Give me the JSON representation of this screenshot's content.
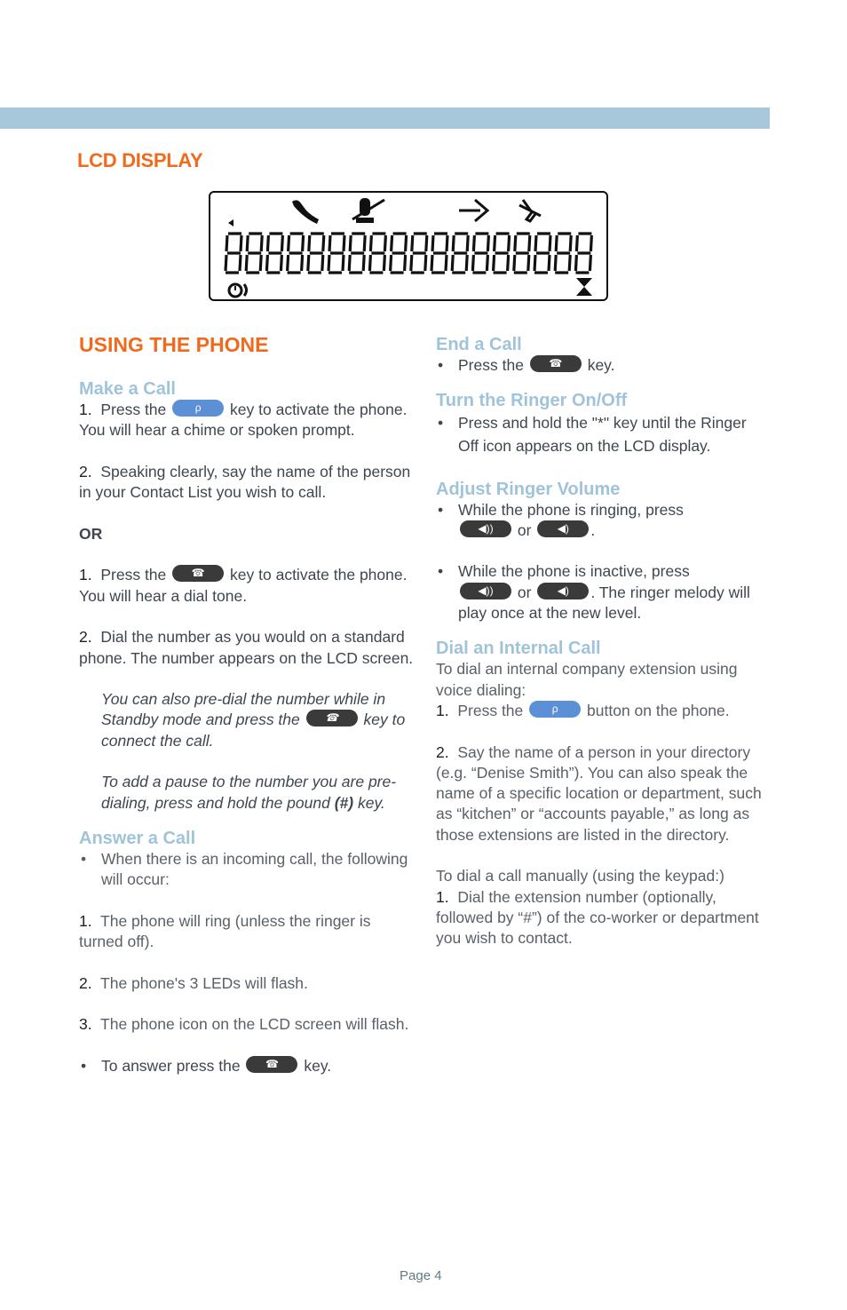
{
  "header": {
    "bar_color": "#a7c8da"
  },
  "lcd_section": {
    "title": "LCD DISPLAY",
    "lcd": {
      "digit_count": 18,
      "digit_glyph": "8",
      "top_icons": [
        "handset-icon",
        "mute-mic-icon",
        "forward-arrow-icon",
        "ringer-off-icon"
      ],
      "left_icon": "volume-arrow-icon",
      "bottom_left_icon": "clock-call-icon",
      "bottom_right_icon": "hourglass-icon"
    }
  },
  "using_section": {
    "title": "USING THE PHONE",
    "make_call": {
      "heading": "Make a Call",
      "step1_num": "1.",
      "step1_pre": "Press the",
      "step1_post": "key to activate the phone. You will hear a chime or spoken prompt.",
      "step2_num": "2.",
      "step2_text": "Speaking clearly, say the name of the person in your Contact List you wish to call.",
      "or_label": "OR",
      "alt1_num": "1.",
      "alt1_pre": "Press the",
      "alt1_post": "key to activate the phone. You will hear a dial tone.",
      "alt2_num": "2.",
      "alt2_text": "Dial the number as you would on a standard phone. The number appears on the LCD screen.",
      "note1_pre": "You can also pre-dial the number while in Standby mode and press the",
      "note1_post": "key to connect the call.",
      "note2_pre": "To add a pause to the number you are pre-dialing, press and hold the pound",
      "note2_bold": "(#)",
      "note2_post": "key."
    },
    "answer_call": {
      "heading": "Answer a Call",
      "bullet1": "When there is an incoming call, the following will occur:",
      "items": [
        {
          "num": "1.",
          "text": "The phone will ring (unless the ringer is turned off)."
        },
        {
          "num": "2.",
          "text": "The phone's 3 LEDs will flash."
        },
        {
          "num": "3.",
          "text": "The phone icon on the LCD screen will flash."
        }
      ],
      "bullet2_pre": "To answer press the",
      "bullet2_post": "key."
    },
    "end_call": {
      "heading": "End a Call",
      "bullet_pre": "Press the",
      "bullet_post": "key."
    },
    "ringer_onoff": {
      "heading": "Turn the Ringer On/Off",
      "bullet": "Press and hold the \"*\" key until the Ringer Off icon appears on the LCD display."
    },
    "ringer_volume": {
      "heading": "Adjust Ringer Volume",
      "bullet1_pre": "While the phone is ringing, press",
      "bullet1_or": "or",
      "bullet1_post": ".",
      "bullet2_pre": "While the phone is inactive, press",
      "bullet2_or": "or",
      "bullet2_post": ". The ringer melody will play once at the new level."
    },
    "internal_call": {
      "heading": "Dial an Internal Call",
      "intro": "To dial an internal company extension using voice dialing:",
      "step1_num": "1.",
      "step1_pre": "Press the",
      "step1_post": "button on the phone.",
      "step2_num": "2.",
      "step2_text": "Say the name of a person in your directory (e.g. “Denise Smith”). You can also speak the name of a specific location or department, such as “kitchen” or “accounts payable,” as long as those extensions are listed in the directory.",
      "manual_intro": "To dial a call manually (using the keypad:)",
      "manual1_num": "1.",
      "manual1_text": "Dial the extension number (optionally, followed by “#”) of the co-worker or department you wish to contact."
    }
  },
  "keys": {
    "voice_key_glyph": "ρ",
    "handset_key_glyph": "☎",
    "volume_up_glyph": "◀))",
    "volume_down_glyph": "◀)"
  },
  "footer": {
    "page_label": "Page 4"
  },
  "colors": {
    "orange": "#f06a1e",
    "subheading_blue": "#9fc4d9",
    "voice_key": "#5b8fd6",
    "dark_key": "#3a3a3a"
  }
}
